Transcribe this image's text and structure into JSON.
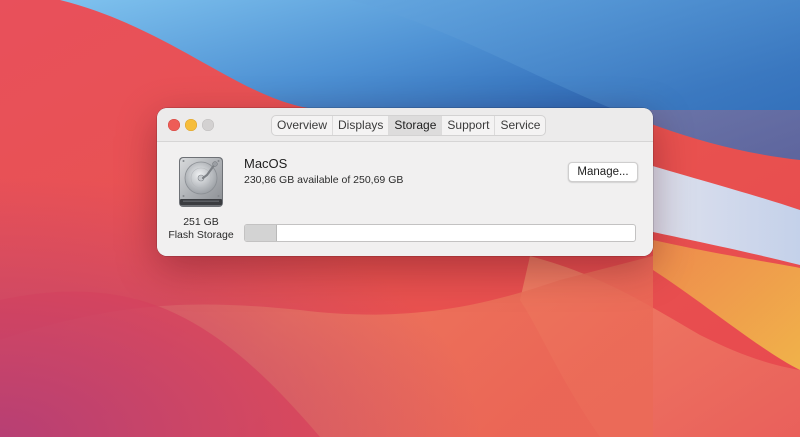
{
  "window": {
    "tabs": [
      {
        "label": "Overview"
      },
      {
        "label": "Displays"
      },
      {
        "label": "Storage"
      },
      {
        "label": "Support"
      },
      {
        "label": "Service"
      }
    ],
    "selected_tab": "Storage"
  },
  "drive": {
    "icon": "hard-drive-icon",
    "size": "251 GB",
    "kind": "Flash Storage"
  },
  "volume": {
    "name": "MacOS",
    "available_text": "230,86 GB available of 250,69 GB",
    "available_gb": 230.86,
    "total_gb": 250.69,
    "used_fraction": 0.079,
    "manage_label": "Manage..."
  },
  "colors": {
    "close": "#ee5d57",
    "minimize": "#f6bd3b",
    "zoom_inactive": "#d3d1d1",
    "used_segment": "#d3d3d3"
  }
}
